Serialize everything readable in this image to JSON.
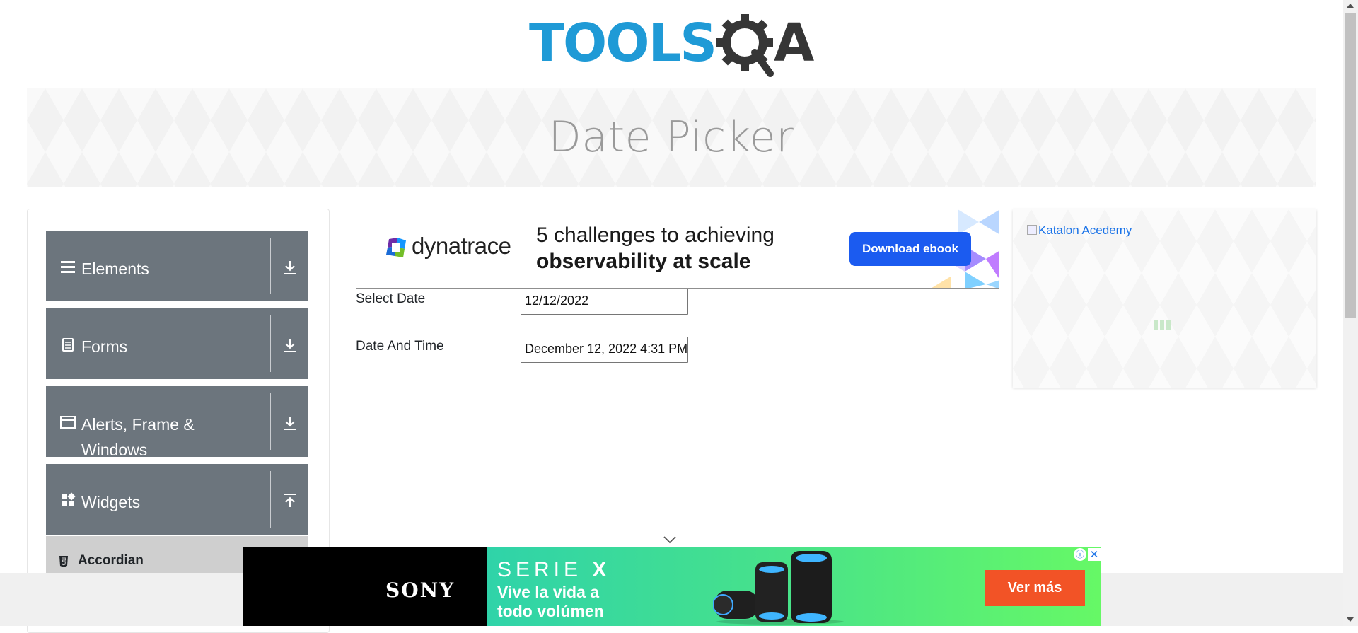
{
  "header": {
    "logo_text": "TOOLSQA"
  },
  "banner": {
    "title": "Date Picker"
  },
  "sidebar": {
    "groups": [
      {
        "label": "Elements",
        "icon": "hamburger-icon",
        "toggle": "download-icon"
      },
      {
        "label": "Forms",
        "icon": "document-icon",
        "toggle": "download-icon"
      },
      {
        "label": "Alerts, Frame & Windows",
        "icon": "window-icon",
        "toggle": "download-icon"
      },
      {
        "label": "Widgets",
        "icon": "widgets-icon",
        "toggle": "upload-icon"
      }
    ],
    "submenu": {
      "label": "Accordian",
      "icon": "html5-icon"
    }
  },
  "ad_top": {
    "brand": "dynatrace",
    "line1": "5 challenges to achieving",
    "line2": "observability at scale",
    "cta": "Download ebook",
    "cta_color": "#1b5bf0"
  },
  "form": {
    "select_date": {
      "label": "Select Date",
      "value": "12/12/2022"
    },
    "date_and_time": {
      "label": "Date And Time",
      "value": "December 12, 2022 4:31 PM"
    }
  },
  "ad_right": {
    "alt_text": "Katalon Acedemy"
  },
  "ad_bottom": {
    "brand": "SONY",
    "series": "SERIE",
    "series_letter": "X",
    "tagline": "Vive la vida a todo volúmen",
    "cta": "Ver más",
    "cta_color": "#f25326",
    "adchoices": "ⓘ",
    "close": "✕"
  },
  "colors": {
    "sidebar_group": "#6c757d",
    "logo_blue": "#1f9ad6",
    "logo_dark": "#363636"
  }
}
